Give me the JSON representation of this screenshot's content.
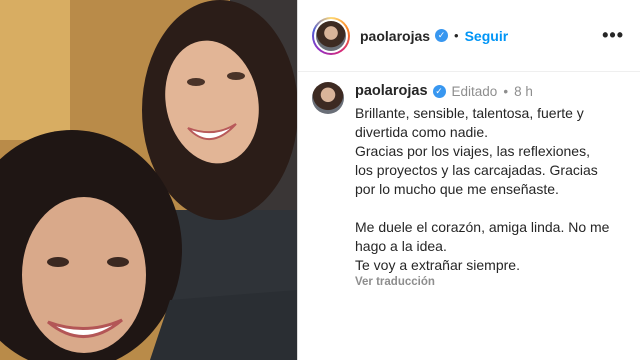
{
  "post": {
    "username": "paolarojas",
    "verified_icon": "verified-badge-icon",
    "follow_label": "Seguir",
    "more_label": "•••"
  },
  "caption": {
    "username": "paolarojas",
    "edited_label": "Editado",
    "time_ago": "8 h",
    "lines": [
      "Brillante, sensible, talentosa, fuerte y",
      "divertida como nadie.",
      "Gracias por los viajes, las reflexiones,",
      "los proyectos y las carcajadas. Gracias",
      "por lo mucho que me enseñaste.",
      "Me duele el corazón, amiga linda. No me",
      "hago a la idea.",
      "Te voy a extrañar siempre."
    ],
    "translate_label": "Ver traducción"
  },
  "colors": {
    "link_blue": "#0095f6",
    "verified_blue": "#3897f0",
    "muted_gray": "#8e8e8e",
    "text": "#262626"
  }
}
